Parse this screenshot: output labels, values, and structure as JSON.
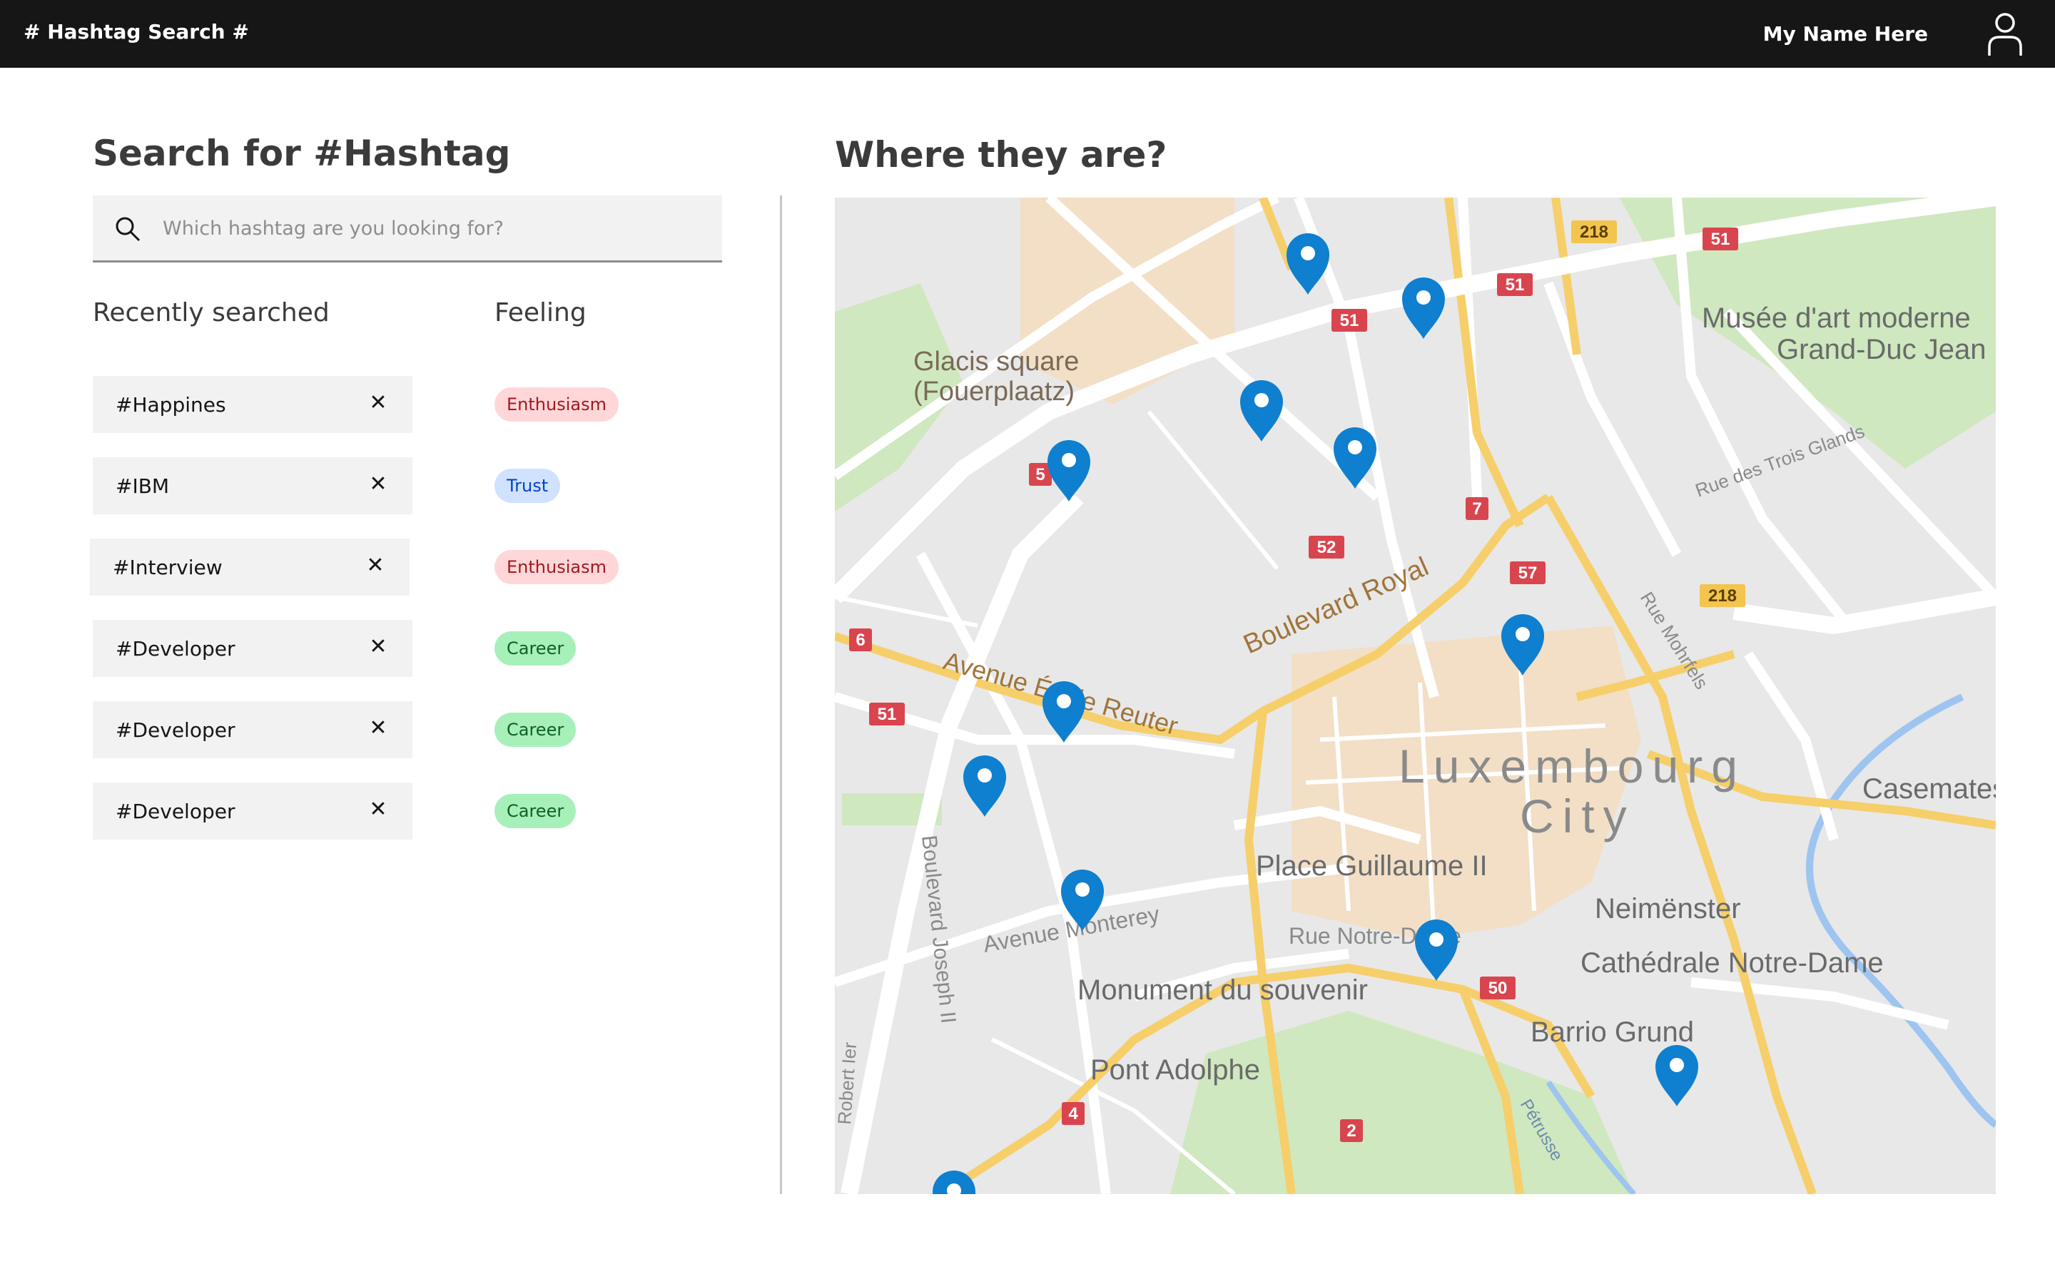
{
  "header": {
    "brand": "# Hashtag Search #",
    "user_name": "My Name Here",
    "user_icon": "user-icon"
  },
  "search": {
    "title": "Search for #Hashtag",
    "placeholder": "Which hashtag are you looking for?",
    "value": "",
    "icon": "search-icon"
  },
  "columns": {
    "recent": "Recently searched",
    "feeling": "Feeling"
  },
  "history": [
    {
      "tag": "#Happines",
      "feeling": "Enthusiasm",
      "feeling_color": "#ffd7d9",
      "feeling_text_color": "#a2191f"
    },
    {
      "tag": "#IBM",
      "feeling": "Trust",
      "feeling_color": "#d0e2ff",
      "feeling_text_color": "#0043ce"
    },
    {
      "tag": "#Interview",
      "feeling": "Enthusiasm",
      "feeling_color": "#ffd7d9",
      "feeling_text_color": "#a2191f"
    },
    {
      "tag": "#Developer",
      "feeling": "Career",
      "feeling_color": "#a7f0ba",
      "feeling_text_color": "#0e6027"
    },
    {
      "tag": "#Developer",
      "feeling": "Career",
      "feeling_color": "#a7f0ba",
      "feeling_text_color": "#0e6027"
    },
    {
      "tag": "#Developer",
      "feeling": "Career",
      "feeling_color": "#a7f0ba",
      "feeling_text_color": "#0e6027"
    }
  ],
  "close_glyph": "✕",
  "map": {
    "title": "Where they are?",
    "pin_color": "#0f7fcf",
    "labels": {
      "glacis": "Glacis square",
      "fouerplaatz": "(Fouerplaatz)",
      "musee1": "Musée d'art moderne",
      "musee2": "Grand-Duc Jean",
      "trois_glands": "Rue des Trois Glands",
      "boulevard_royal": "Boulevard Royal",
      "avenue_reuter": "Avenue Émile Reuter",
      "luxembourg": "Luxembourg",
      "city": "City",
      "casemates": "Casemates",
      "place_guillaume": "Place Guillaume II",
      "neimenster": "Neimënster",
      "cathedrale": "Cathédrale Notre-Dame",
      "rue_notre_dame": "Rue Notre-Dame",
      "avenue_monterey": "Avenue Monterey",
      "monument": "Monument du souvenir",
      "barrio_grund": "Barrio Grund",
      "pont_adolphe": "Pont Adolphe",
      "boulevard_joseph": "Boulevard Joseph II",
      "rue_mohrfels": "Rue Mohrfels",
      "petrusse": "Pétrusse",
      "robert": "Robert Ier"
    },
    "road_numbers": {
      "r51a": "51",
      "r51b": "51",
      "r51c": "51",
      "r51d": "51",
      "r218a": "218",
      "r218b": "218",
      "r7": "7",
      "r52": "52",
      "r57": "57",
      "r6": "6",
      "r50": "50",
      "r4": "4",
      "r2": "2",
      "r5": "5"
    }
  }
}
